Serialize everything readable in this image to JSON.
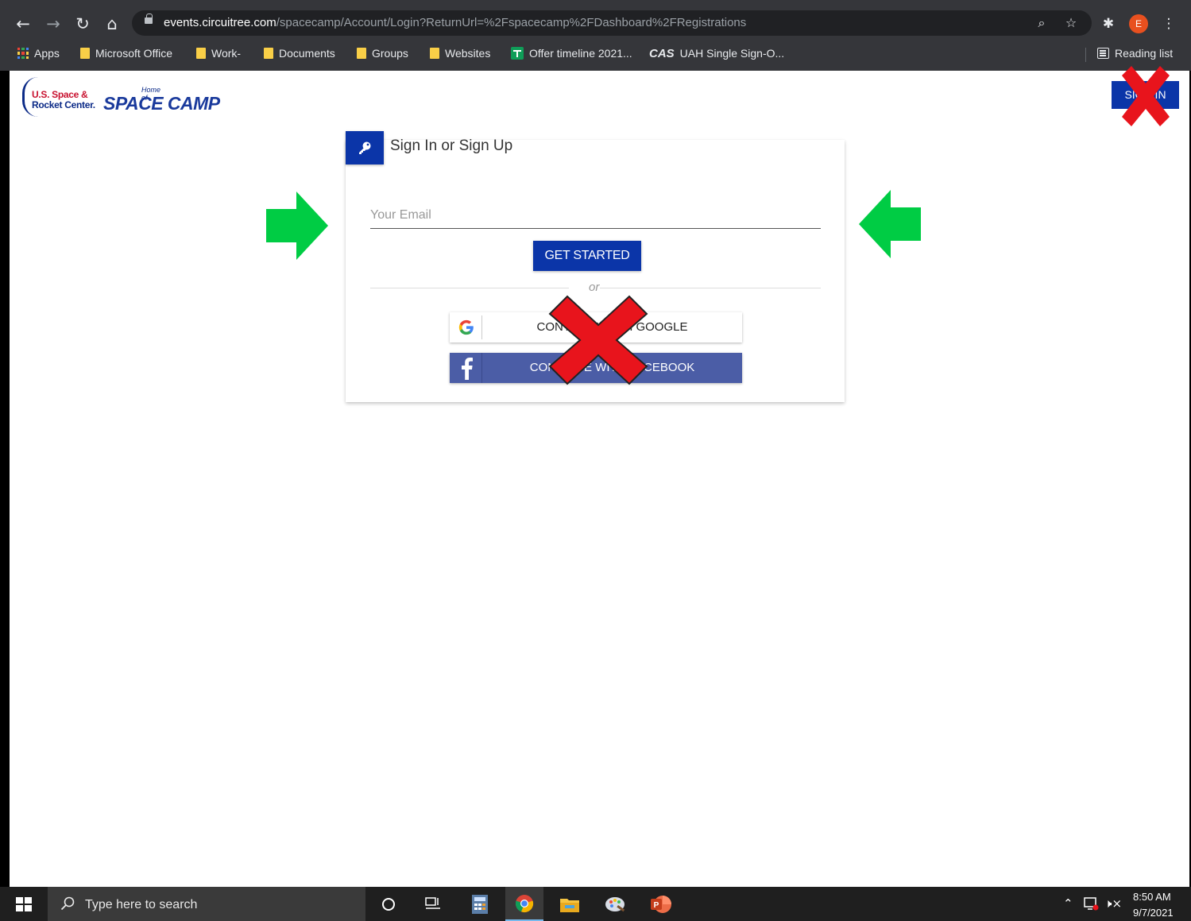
{
  "browser": {
    "url_host": "events.circuitree.com",
    "url_path": "/spacecamp/Account/Login?ReturnUrl=%2Fspacecamp%2FDashboard%2FRegistrations",
    "profile_initial": "E",
    "bookmarks": [
      {
        "label": "Apps",
        "icon": "apps-grid-icon"
      },
      {
        "label": "Microsoft Office",
        "icon": "folder-icon"
      },
      {
        "label": "Work-",
        "icon": "folder-icon"
      },
      {
        "label": "Documents",
        "icon": "folder-icon"
      },
      {
        "label": "Groups",
        "icon": "folder-icon"
      },
      {
        "label": "Websites",
        "icon": "folder-icon"
      },
      {
        "label": "Offer timeline 2021...",
        "icon": "sheets-icon"
      },
      {
        "label": "UAH Single Sign-O...",
        "icon": "cas-icon"
      }
    ],
    "cas_logo_text": "CAS",
    "reading_list": "Reading list"
  },
  "header": {
    "logo_line1": "U.S. Space &",
    "logo_line2": "Rocket Center.",
    "home_of": "Home of",
    "brand": "SPACE CAMP",
    "signin_label": "SIGN IN"
  },
  "login": {
    "title": "Sign In or Sign Up",
    "email_placeholder": "Your Email",
    "email_value": "",
    "get_started": "GET STARTED",
    "or_text": "or",
    "google_label": "CONTINUE WITH GOOGLE",
    "facebook_label": "CONTINUE WITH FACEBOOK"
  },
  "annotations": {
    "arrow_color": "#00cc44",
    "x_color": "#e8141c"
  },
  "taskbar": {
    "search_placeholder": "Type here to search",
    "apps": [
      "cortana-icon",
      "task-view-icon",
      "calculator-icon",
      "chrome-icon",
      "file-explorer-icon",
      "paint-icon",
      "powerpoint-icon"
    ],
    "time": "8:50 AM",
    "date": "9/7/2021"
  }
}
